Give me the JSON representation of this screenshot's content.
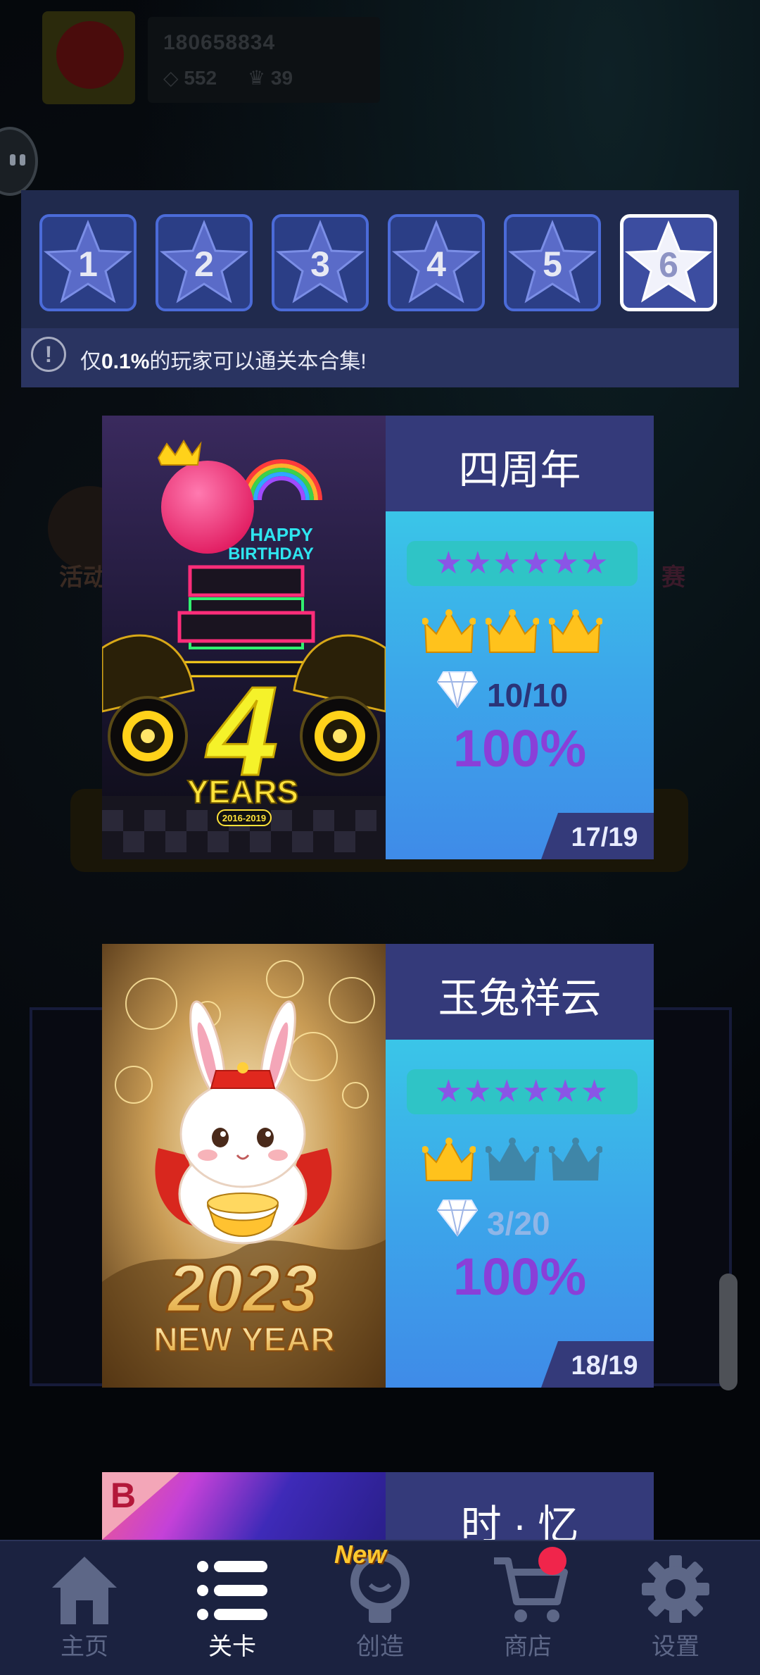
{
  "profile": {
    "username": "180658834",
    "diamonds": "552",
    "crowns": "39"
  },
  "level_tabs": [
    "1",
    "2",
    "3",
    "4",
    "5",
    "6"
  ],
  "active_tab": "6",
  "notice": {
    "prefix": "仅",
    "highlight": "0.1%",
    "suffix": "的玩家可以通关本合集!"
  },
  "background_labels": {
    "left": "活动",
    "right": "赛"
  },
  "cards": [
    {
      "title": "四周年",
      "stars": "★★★★★★",
      "crowns_earned": 3,
      "crowns_total": 3,
      "gems": "10/10",
      "percent": "100%",
      "index": "17/19",
      "art": {
        "line1": "HAPPY",
        "line2": "BIRTHDAY",
        "big": "4",
        "years": "YEARS",
        "range": "2016-2019"
      }
    },
    {
      "title": "玉兔祥云",
      "stars": "★★★★★★",
      "crowns_earned": 1,
      "crowns_total": 3,
      "gems": "3/20",
      "percent": "100%",
      "index": "18/19",
      "art": {
        "year": "2023",
        "caption": "NEW YEAR"
      }
    }
  ],
  "card3": {
    "badge": "B",
    "title": "时 · 忆"
  },
  "nav": {
    "items": [
      {
        "label": "主页",
        "icon": "home-icon"
      },
      {
        "label": "关卡",
        "icon": "levels-list-icon"
      },
      {
        "label": "创造",
        "icon": "lightbulb-icon"
      },
      {
        "label": "商店",
        "icon": "cart-icon"
      },
      {
        "label": "设置",
        "icon": "gear-icon"
      }
    ],
    "active": "关卡",
    "new_badge": "New"
  },
  "colors": {
    "panel": "#202a4d",
    "tab_border": "#4b6bd8",
    "stars": "#8a55e6",
    "percent": "#8a3fd8",
    "crown_gold": "#ffc21c",
    "crown_dim": "#3f86a8",
    "nav_bg": "#1b2240"
  }
}
